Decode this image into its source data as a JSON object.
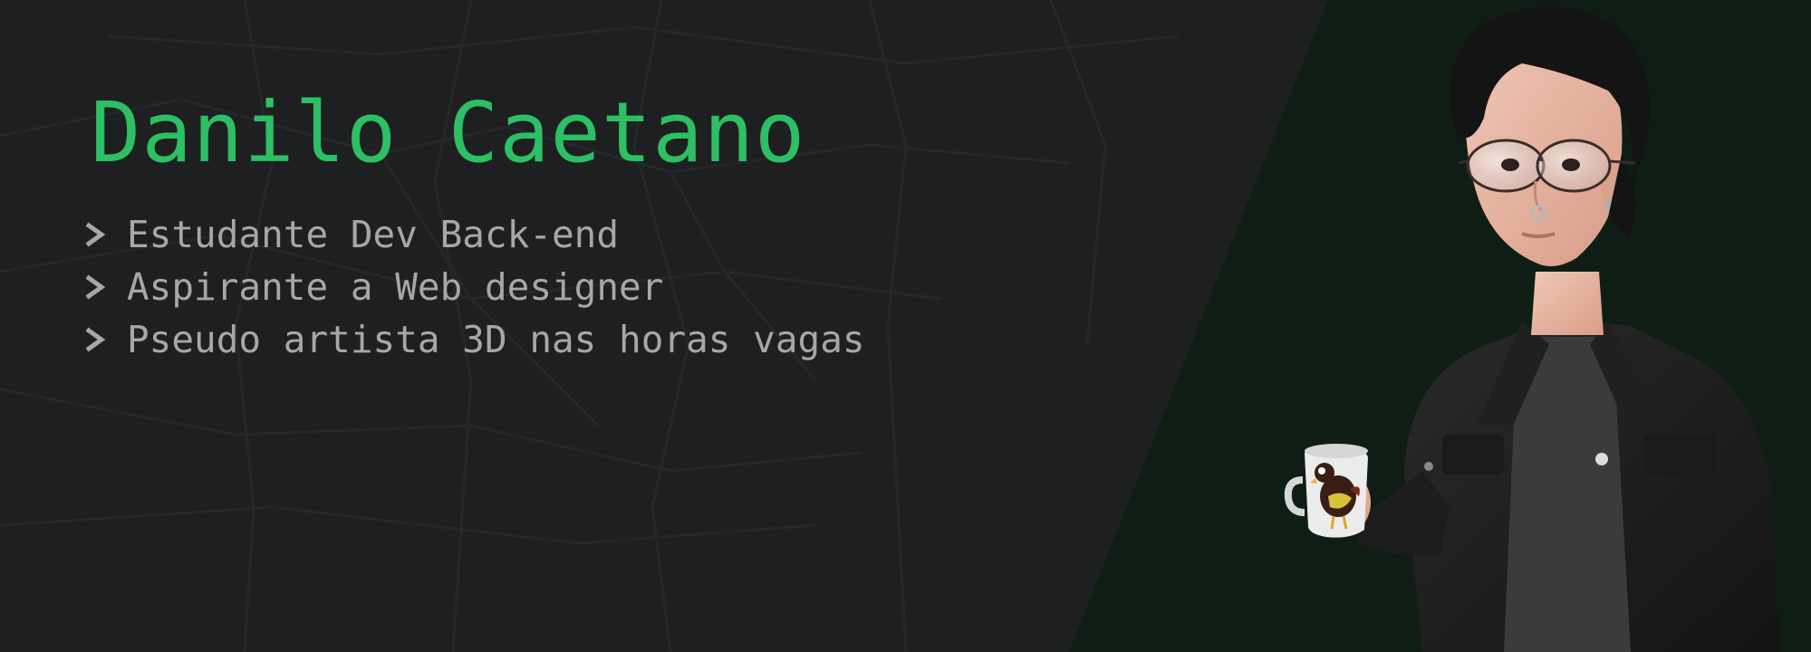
{
  "profile": {
    "name": "Danilo Caetano",
    "lines": [
      "Estudante Dev Back-end",
      "Aspirante a Web designer",
      "Pseudo artista 3D nas horas vagas"
    ]
  },
  "colors": {
    "accent": "#2dbf63",
    "background": "#1e1f21",
    "panel": "#0f1e14",
    "text": "#a6a7a8"
  },
  "icons": {
    "bullet": "chevron-right-icon",
    "illustration": "3d-avatar-illustration",
    "mug": "chicken-mug"
  }
}
